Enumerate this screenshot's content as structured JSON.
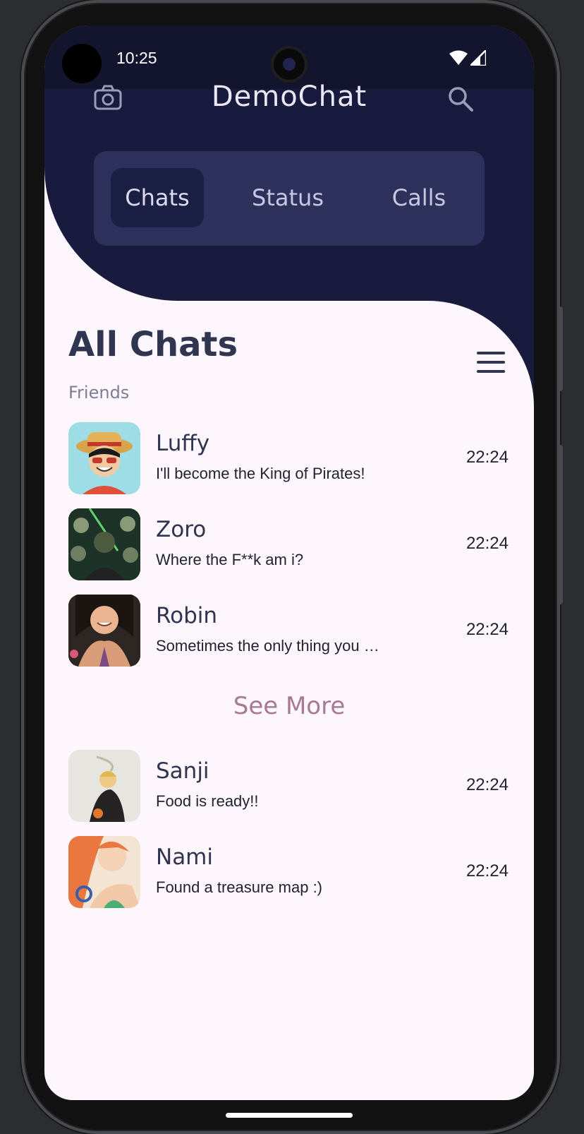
{
  "status_bar": {
    "time": "10:25"
  },
  "header": {
    "title": "DemoChat",
    "camera_icon": "camera-icon",
    "search_icon": "search-icon",
    "tabs": [
      {
        "label": "Chats",
        "active": true
      },
      {
        "label": "Status",
        "active": false
      },
      {
        "label": "Calls",
        "active": false
      }
    ]
  },
  "main": {
    "title": "All Chats",
    "subtitle": "Friends",
    "menu_icon": "menu-icon",
    "chats": [
      {
        "name": "Luffy",
        "message": "I'll become the King of Pirates!",
        "time": "22:24"
      },
      {
        "name": "Zoro",
        "message": "Where the F**k am i?",
        "time": "22:24"
      },
      {
        "name": "Robin",
        "message": "Sometimes the only thing you …",
        "time": "22:24"
      },
      {
        "name": "Sanji",
        "message": "Food is ready!!",
        "time": "22:24"
      },
      {
        "name": "Nami",
        "message": "Found a treasure map :)",
        "time": "22:24"
      }
    ],
    "see_more": "See More"
  },
  "colors": {
    "header_bg": "#181a3e",
    "tab_bar_bg": "#2d315c",
    "body_bg": "#fdf6fc",
    "accent": "#a67a93"
  }
}
